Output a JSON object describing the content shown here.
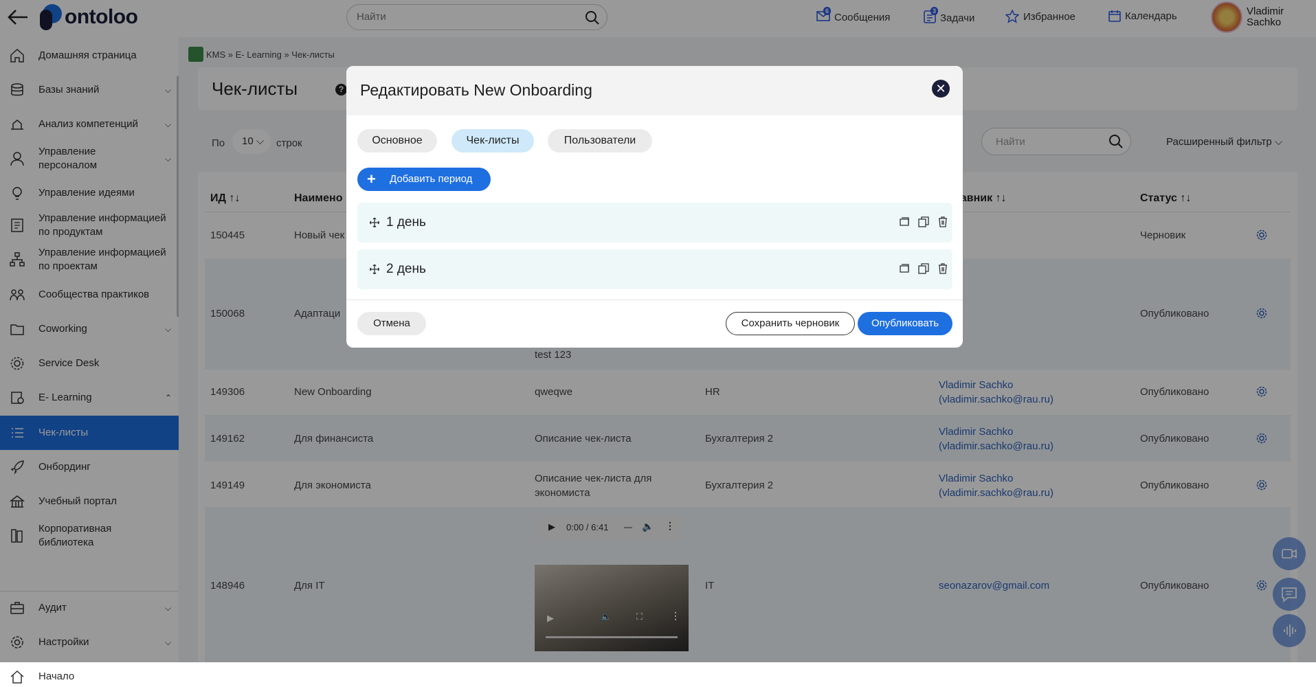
{
  "header": {
    "logo_text": "ontoloo",
    "search_placeholder": "Найти",
    "nav": [
      {
        "label": "Сообщения",
        "badge": "6"
      },
      {
        "label": "Задачи",
        "badge": "3"
      },
      {
        "label": "Избранное"
      },
      {
        "label": "Календарь"
      }
    ],
    "user_first": "Vladimir",
    "user_last": "Sachko"
  },
  "sidebar": {
    "items": [
      {
        "label": "Домашняя страница"
      },
      {
        "label": "Базы знаний"
      },
      {
        "label": "Анализ компетенций"
      },
      {
        "label": "Управление персоналом"
      },
      {
        "label": "Управление идеями"
      },
      {
        "label": "Управление информацией по продуктам"
      },
      {
        "label": "Управление информацией по проектам"
      },
      {
        "label": "Сообщества практиков"
      },
      {
        "label": "Coworking"
      },
      {
        "label": "Service Desk"
      },
      {
        "label": "E- Learning"
      },
      {
        "label": "Чек-листы"
      },
      {
        "label": "Онбординг"
      },
      {
        "label": "Учебный портал"
      },
      {
        "label": "Корпоративная библиотека"
      },
      {
        "label": "Аудит"
      },
      {
        "label": "Настройки"
      },
      {
        "label": "Начало"
      }
    ]
  },
  "main": {
    "breadcrumb": "KMS » E- Learning » Чек-листы",
    "title": "Чек-листы",
    "per_label": "По",
    "per_value": "10",
    "rows_label": "строк",
    "search_placeholder": "Найти",
    "advanced_filter": "Расширенный фильтр",
    "columns": {
      "id": "ИД",
      "name": "Наимено",
      "author": "тавник",
      "status": "Статус"
    },
    "rows": [
      {
        "id": "150445",
        "name": "Новый чек",
        "desc": "",
        "dept": "",
        "author": "",
        "status": "Черновик"
      },
      {
        "id": "150068",
        "name": "Адаптаци",
        "desc": "test 123",
        "dept": "",
        "author": "",
        "status": "Опубликовано"
      },
      {
        "id": "149306",
        "name": "New Onboarding",
        "desc": "qweqwe",
        "dept": "HR",
        "author": "Vladimir Sachko (vladimir.sachko@rau.ru)",
        "status": "Опубликовано"
      },
      {
        "id": "149162",
        "name": "Для финансиста",
        "desc": "Описание чек-листа",
        "dept": "Бухгалтерия 2",
        "author": "Vladimir Sachko (vladimir.sachko@rau.ru)",
        "status": "Опубликовано"
      },
      {
        "id": "149149",
        "name": "Для экономиста",
        "desc": "Описание чек-листа для экономиста",
        "dept": "Бухгалтерия 2",
        "author": "Vladimir Sachko (vladimir.sachko@rau.ru)",
        "status": "Опубликовано"
      },
      {
        "id": "148946",
        "name": "Для IT",
        "desc": "",
        "dept": "IT",
        "author": "seonazarov@gmail.com",
        "status": "Опубликовано"
      }
    ],
    "audio_time": "0:00 / 6:41"
  },
  "modal": {
    "title": "Редактировать New Onboarding",
    "tabs": [
      {
        "label": "Основное",
        "active": false
      },
      {
        "label": "Чек-листы",
        "active": true
      },
      {
        "label": "Пользователи",
        "active": false
      }
    ],
    "add_period": "Добавить период",
    "periods": [
      {
        "label": "1 день"
      },
      {
        "label": "2 день"
      }
    ],
    "cancel": "Отмена",
    "save_draft": "Сохранить черновик",
    "publish": "Опубликовать"
  },
  "colors": {
    "accent": "#1e6fe0",
    "overlay": "rgba(0,0,0,0.40)",
    "brand": "#1b1f3b"
  }
}
